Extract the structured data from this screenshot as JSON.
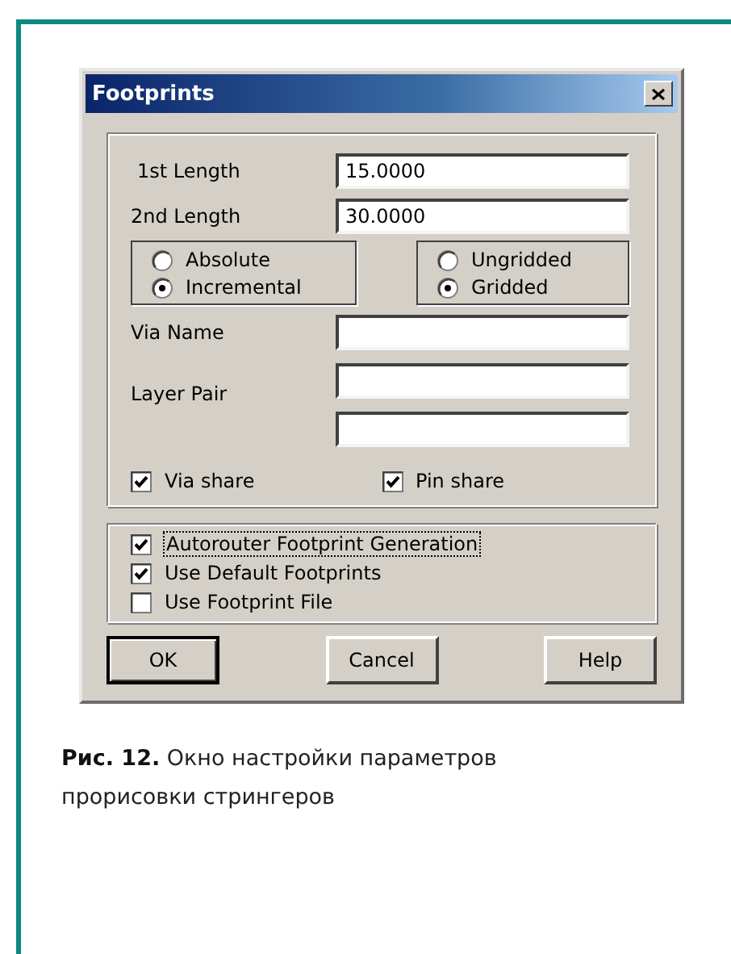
{
  "window": {
    "title": "Footprints"
  },
  "lengths": [
    {
      "label": "1st Length",
      "value": "15.0000"
    },
    {
      "label": "2nd Length",
      "value": "30.0000"
    }
  ],
  "radio_groups": [
    {
      "options": [
        {
          "label": "Absolute",
          "selected": false
        },
        {
          "label": "Incremental",
          "selected": true
        }
      ]
    },
    {
      "options": [
        {
          "label": "Ungridded",
          "selected": false
        },
        {
          "label": "Gridded",
          "selected": true
        }
      ]
    }
  ],
  "via_name": {
    "label": "Via Name"
  },
  "layer_pair": {
    "label": "Layer Pair",
    "fields": [
      {
        "kind": "text"
      },
      {
        "kind": "text"
      }
    ]
  },
  "shares": [
    {
      "label": "Via share",
      "checked": true
    },
    {
      "label": "Pin share",
      "checked": true
    }
  ],
  "options": [
    {
      "label": "Autorouter Footprint Generation",
      "checked": true,
      "focused": true
    },
    {
      "label": "Use Default Footprints",
      "checked": true,
      "focused": false
    },
    {
      "label": "Use Footprint File",
      "checked": false,
      "focused": false
    }
  ],
  "buttons": [
    {
      "label": "OK",
      "default": true
    },
    {
      "label": "Cancel",
      "default": false
    },
    {
      "label": "Help",
      "default": false
    }
  ],
  "caption": "**Рис. 12.** Окно настройки параметров прорисовки стрингеров"
}
